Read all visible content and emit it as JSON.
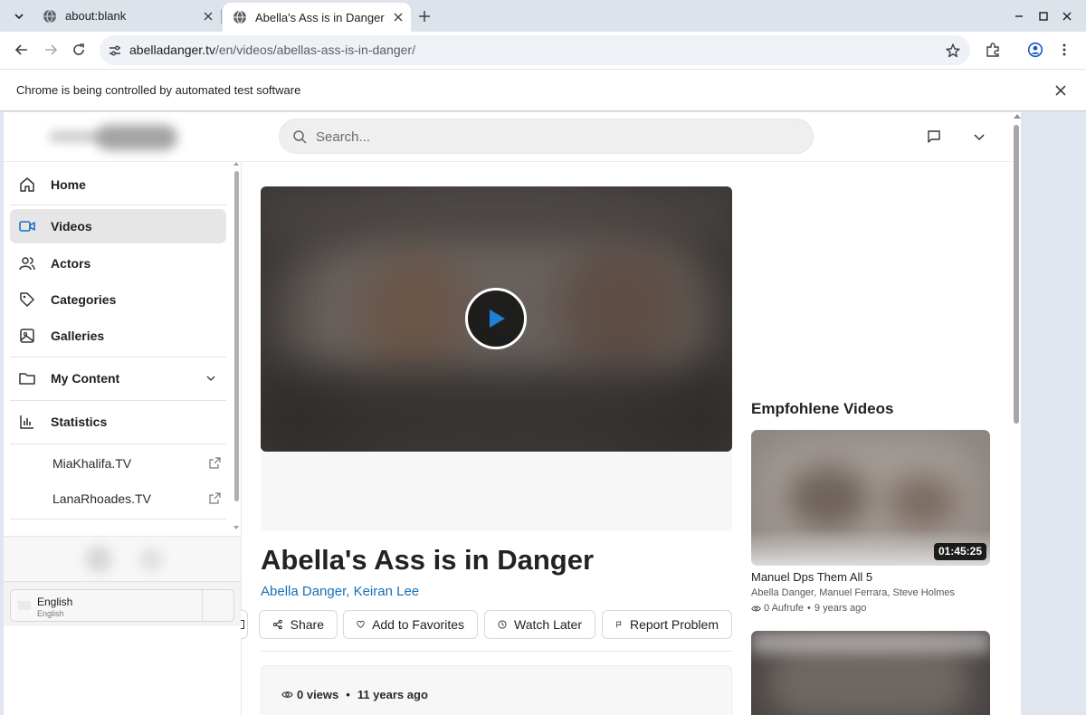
{
  "browser": {
    "tabs": [
      {
        "title": "about:blank"
      },
      {
        "title": "Abella's Ass is in Danger"
      }
    ],
    "url_host": "abelladanger.tv",
    "url_path": "/en/videos/abellas-ass-is-in-danger/",
    "infobar_text": "Chrome is being controlled by automated test software"
  },
  "header": {
    "search_placeholder": "Search..."
  },
  "sidebar": {
    "items": [
      {
        "label": "Home",
        "icon": "home-icon"
      },
      {
        "label": "Videos",
        "icon": "video-camera-icon",
        "active": true
      },
      {
        "label": "Actors",
        "icon": "users-icon"
      },
      {
        "label": "Categories",
        "icon": "tag-icon"
      },
      {
        "label": "Galleries",
        "icon": "image-icon"
      },
      {
        "label": "My Content",
        "icon": "folder-icon"
      },
      {
        "label": "Statistics",
        "icon": "bar-chart-icon"
      }
    ],
    "external_links": [
      {
        "label": "MiaKhalifa.TV"
      },
      {
        "label": "LanaRhoades.TV"
      }
    ],
    "language": {
      "name": "English",
      "native": "English"
    }
  },
  "video": {
    "title": "Abella's Ass is in Danger",
    "actors": [
      "Abella Danger",
      "Keiran Lee"
    ],
    "actors_separator": ", ",
    "actions": [
      {
        "label": "Share",
        "icon": "share-icon"
      },
      {
        "label": "Add to Favorites",
        "icon": "heart-icon"
      },
      {
        "label": "Watch Later",
        "icon": "clock-icon"
      },
      {
        "label": "Report Problem",
        "icon": "flag-icon"
      }
    ],
    "views": "0 views",
    "age": "11 years ago"
  },
  "recommended": {
    "heading": "Empfohlene Videos",
    "items": [
      {
        "duration": "01:45:25",
        "title": "Manuel Dps Them All 5",
        "actors": "Abella Danger, Manuel Ferrara, Steve Holmes",
        "views": "0 Aufrufe",
        "age": "9 years ago"
      }
    ]
  },
  "colors": {
    "link_blue": "#1570b8",
    "play_triangle": "#1e7fd6",
    "active_sidebar_bg": "#e6e6e6"
  }
}
